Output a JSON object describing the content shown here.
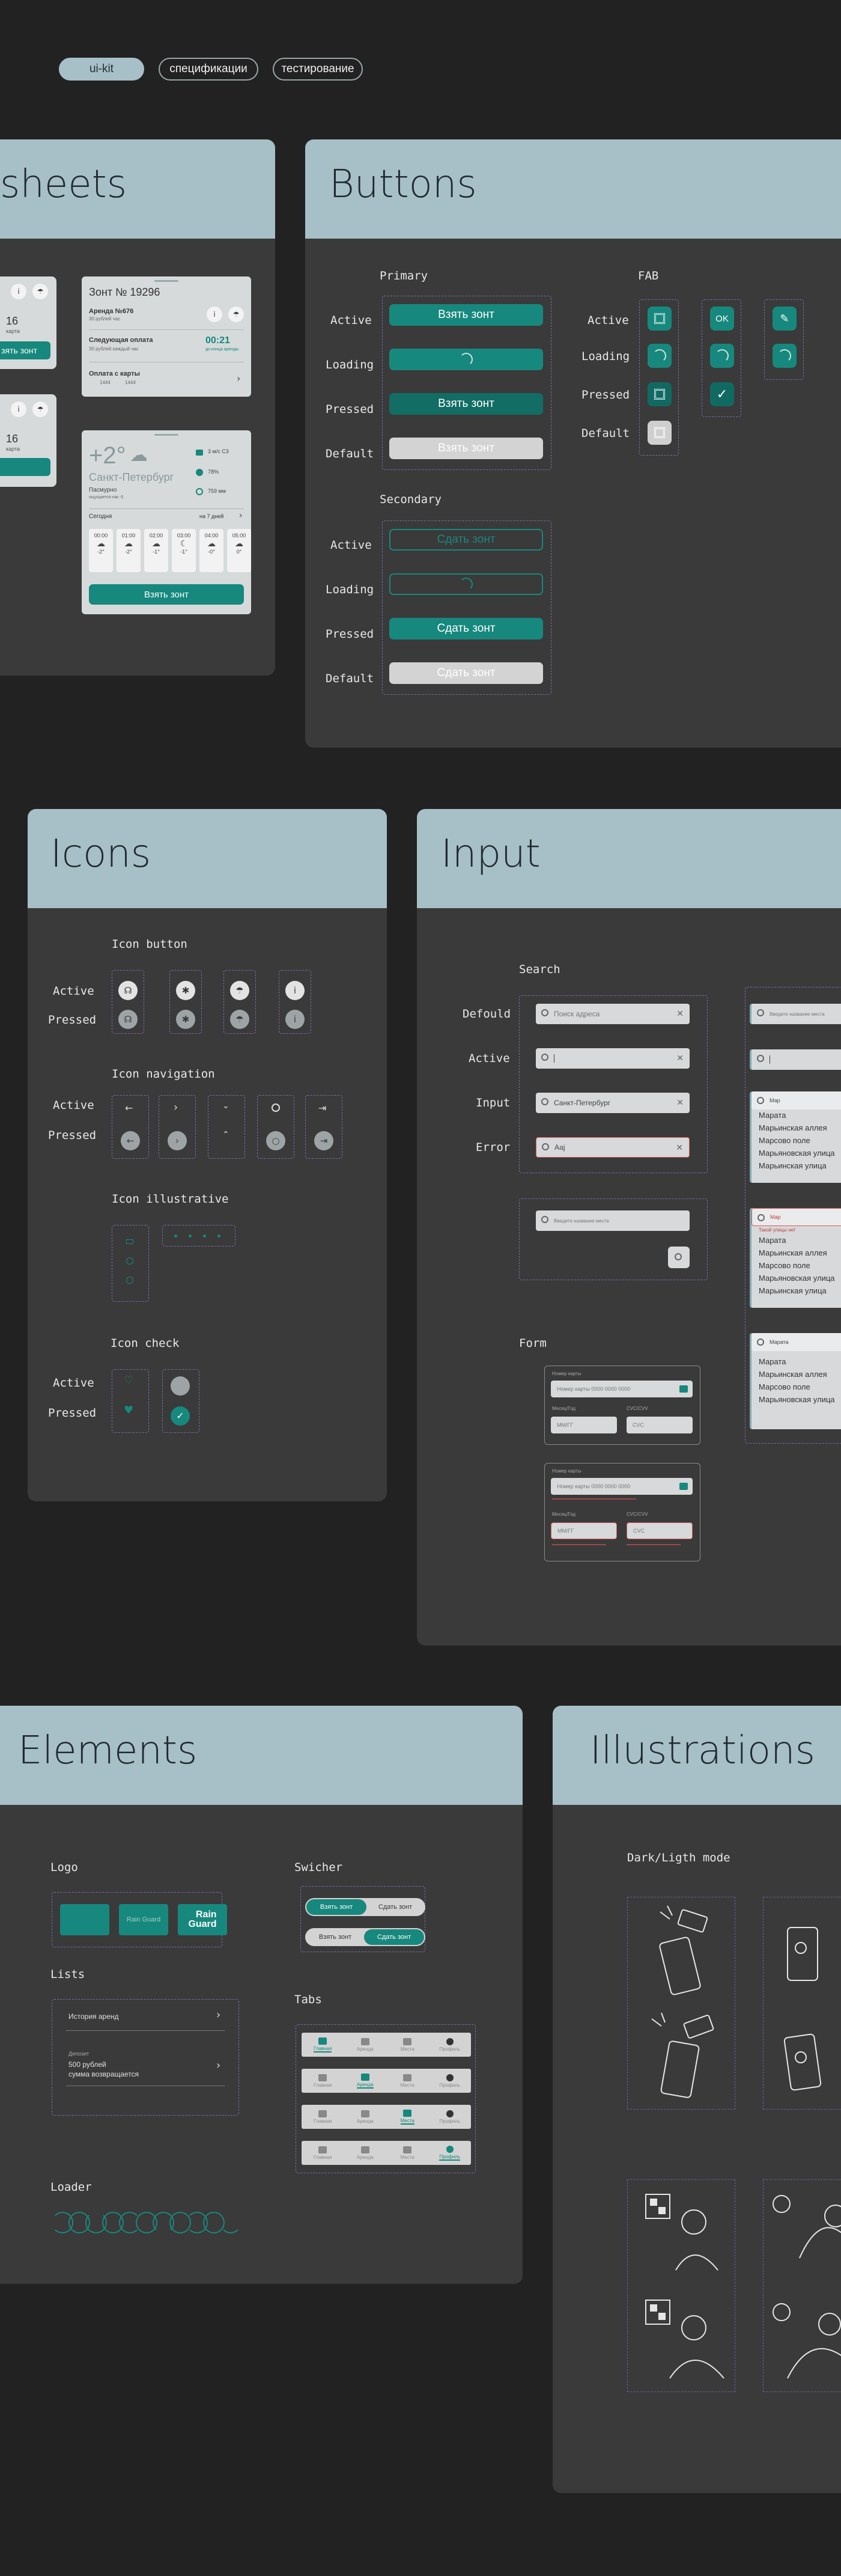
{
  "top_tabs": [
    {
      "label": "ui-kit",
      "active": true
    },
    {
      "label": "спецификации",
      "active": false
    },
    {
      "label": "тестирование",
      "active": false
    }
  ],
  "sheets": {
    "title": "sheets",
    "card1": {
      "title": "Зонт № 19296",
      "rent_title": "Аренда №676",
      "rent_sub": "30 рублей час",
      "next_pay": "Следующая оплата",
      "next_pay_sub": "30 рублей каждый час",
      "timer": "00:21",
      "timer_sub": "до конца аренды",
      "pay_method": "Оплата с карты",
      "card_mask": "1444",
      "card_extra": "1444"
    },
    "left_partial": {
      "num": "16",
      "unit": "карта",
      "btn": "зять зонт"
    },
    "weather": {
      "temp": "+2°",
      "city": "Санкт-Петербург",
      "date": "Пасмурно",
      "date_sub": "ощущается как -5",
      "wind": "3 м/с С3",
      "humidity": "78%",
      "pressure": "759 мм",
      "today": "Сегодня",
      "week": "на 7 дней",
      "hours": [
        {
          "time": "00:00",
          "temp": "-2°"
        },
        {
          "time": "01:00",
          "temp": "-2°"
        },
        {
          "time": "02:00",
          "temp": "-1°"
        },
        {
          "time": "03:00",
          "temp": "-1°"
        },
        {
          "time": "04:00",
          "temp": "-0°"
        },
        {
          "time": "05:00",
          "temp": "0°"
        }
      ],
      "btn": "Взять зонт"
    }
  },
  "buttons": {
    "title": "Buttons",
    "primary": "Primary",
    "secondary": "Secondary",
    "fab": "FAB",
    "states": [
      "Active",
      "Loading",
      "Pressed",
      "Default"
    ],
    "take": "Взять зонт",
    "give": "Сдать зонт",
    "ok": "OK"
  },
  "icons": {
    "title": "Icons",
    "icon_button": "Icon button",
    "icon_navigation": "Icon navigation",
    "icon_illustrative": "Icon illustrative",
    "icon_check": "Icon check",
    "active": "Active",
    "pressed": "Pressed"
  },
  "input": {
    "title": "Input",
    "search": "Search",
    "form": "Form",
    "states": [
      "Defould",
      "Active",
      "Input",
      "Error"
    ],
    "placeholder": "Поиск адреса",
    "input_value": "Санкт-Петербург",
    "error_value": "Ааj",
    "suggest_placeholder": "Введите название места",
    "list_query1": "Мар",
    "list_items": [
      "Марата",
      "Марьинская аллея",
      "Марсово поле",
      "Марьяновская улица",
      "Марьинская улица"
    ],
    "list_error_query": "Мар",
    "list_error_note": "Такой улицы нет",
    "list_query3": "Марата",
    "list3_items": [
      "Марата",
      "Марьинская аллея",
      "Марсово поле",
      "Марьяновская улица"
    ],
    "form_card_label": "Номер карты",
    "form_card_placeholder": "Номер карты 0000 0000 0000",
    "form_term": "Месяц/Год",
    "form_cvc": "CVC/CVV",
    "form_term_ph": "ММ/ГГ",
    "form_cvc_ph": "CVC"
  },
  "elements": {
    "title": "Elements",
    "logo": "Logo",
    "logo_text_small": "Rain Guard",
    "logo_text_big": "Rain\nGuard",
    "switcher": "Swicher",
    "switch_take": "Взять зонт",
    "switch_give": "Сдать зонт",
    "lists": "Lists",
    "list_history": "История аренд",
    "list_deposit_label": "Депозит",
    "list_deposit_value": "500 рублей",
    "list_deposit_sub": "сумма возвращается",
    "tabs": "Tabs",
    "tab_labels": [
      "Главная",
      "Аренда",
      "Места",
      "Профиль"
    ],
    "loader": "Loader"
  },
  "illustrations": {
    "title": "Illustrations",
    "mode": "Dark/Ligth mode"
  }
}
